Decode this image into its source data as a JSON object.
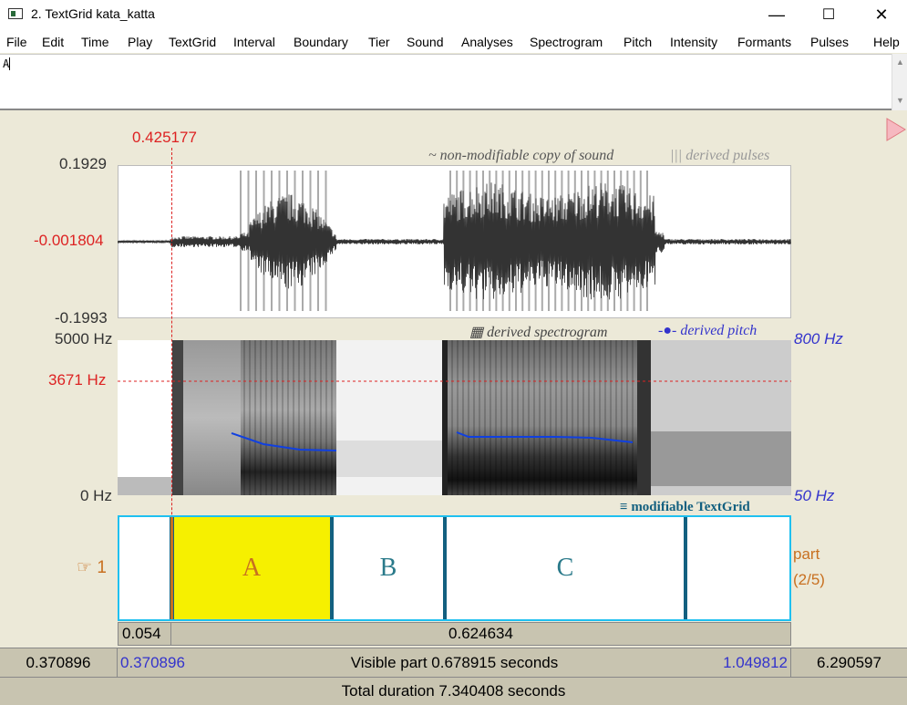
{
  "window": {
    "title": "2. TextGrid kata_katta",
    "minimize": "—",
    "maximize": "☐",
    "close": "✕"
  },
  "menu": [
    "File",
    "Edit",
    "Time",
    "Play",
    "TextGrid",
    "Interval",
    "Boundary",
    "Tier",
    "Sound",
    "Analyses",
    "Spectrogram",
    "Pitch",
    "Intensity",
    "Formants",
    "Pulses",
    "Help"
  ],
  "editor_text": "A",
  "cursor_time": "0.425177",
  "sound": {
    "label": "~ non-modifiable copy of sound",
    "pulses_label": "||| derived pulses",
    "y_max": "0.1929",
    "y_cursor": "-0.001804",
    "y_min": "-0.1993"
  },
  "spectrogram": {
    "label": "derived spectrogram",
    "pitch_label": "derived pitch",
    "freq_max": "5000 Hz",
    "freq_cursor": "3671 Hz",
    "freq_min": "0 Hz",
    "pitch_max": "800 Hz",
    "pitch_min": "50 Hz"
  },
  "textgrid": {
    "label": "modifiable TextGrid",
    "tier_number": "1",
    "tier_hint_top": "part",
    "tier_hint_bottom": "(2/5)",
    "intervals": [
      "",
      "A",
      "B",
      "C",
      ""
    ],
    "selected_interval": "A"
  },
  "bottom": {
    "sel_left_duration": "0.054",
    "sel_right_duration": "0.624634",
    "left_hidden": "0.370896",
    "visible_start": "0.370896",
    "visible_part": "Visible part 0.678915 seconds",
    "visible_end": "1.049812",
    "right_hidden": "6.290597",
    "total": "Total duration 7.340408 seconds"
  },
  "colors": {
    "cursor_red": "#dd2222",
    "selection_yellow": "#f6f000",
    "tier_border": "#1fc0f0",
    "boundary": "#136080",
    "pitch_blue": "#1040e0",
    "blue_text": "#3333cc",
    "orange": "#c87020"
  }
}
